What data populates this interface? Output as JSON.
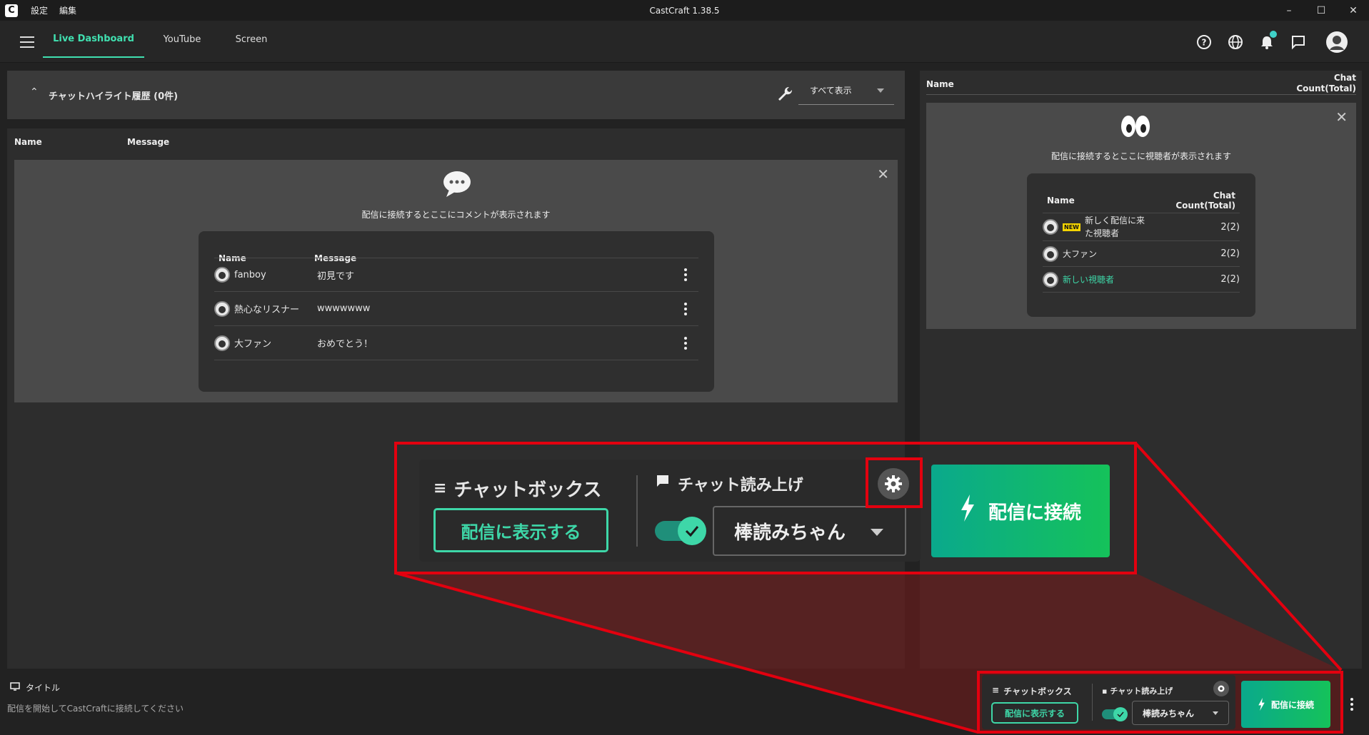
{
  "window": {
    "logo": "C",
    "menu": [
      "設定",
      "編集"
    ],
    "title": "CastCraft 1.38.5",
    "controls": [
      "–",
      "☐",
      "✕"
    ]
  },
  "nav": {
    "tabs": [
      "Live Dashboard",
      "YouTube",
      "Screen"
    ],
    "active_tab": "Live Dashboard",
    "icons": [
      "help-icon",
      "globe-icon",
      "bell-icon",
      "chat-icon",
      "avatar"
    ]
  },
  "highlight": {
    "title": "チャットハイライト履歴 (0件)",
    "filter_value": "すべて表示"
  },
  "comments": {
    "columns": [
      "Name",
      "Message"
    ],
    "empty_text": "配信に接続するとここにコメントが表示されます",
    "sample": [
      {
        "name": "fanboy",
        "message": "初見です"
      },
      {
        "name": "熱心なリスナー",
        "message": "wwwwwww"
      },
      {
        "name": "大ファン",
        "message": "おめでとう！"
      }
    ]
  },
  "viewers": {
    "columns": [
      "Name",
      "Chat Count(Total)"
    ],
    "col_name": "Name",
    "col_count_1": "Chat",
    "col_count_2": "Count(Total)",
    "empty_text": "配信に接続するとここに視聴者が表示されます",
    "new_badge": "NEW",
    "sample": [
      {
        "name_1": "新しく配信に来",
        "name_2": "た視聴者",
        "count": "2(2)"
      },
      {
        "name": "大ファン",
        "count": "2(2)"
      },
      {
        "name": "新しい視聴者",
        "count": "2(2)"
      }
    ]
  },
  "controls": {
    "chatbox_label": "チャットボックス",
    "show_button": "配信に表示する",
    "tts_label": "チャット読み上げ",
    "tts_engine": "棒読みちゃん",
    "tts_enabled": true,
    "connect_button": "配信に接続"
  },
  "footer": {
    "title": "タイトル",
    "subtitle": "配信を開始してCastCraftに接続してください"
  },
  "colors": {
    "accent": "#3ed7a8",
    "highlight_outline": "#e3000f",
    "connect_gradient_start": "#0aa98c",
    "connect_gradient_end": "#15c25a",
    "new_viewer_name": "#3ed7a8"
  }
}
